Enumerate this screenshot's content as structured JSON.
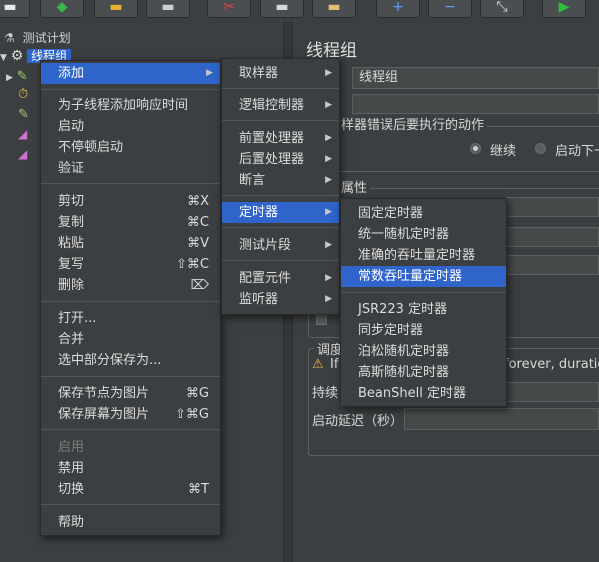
{
  "toolbar": {
    "buttons": [
      "new-icon",
      "templates-icon",
      "open-icon",
      "save-icon",
      "cut-icon",
      "copy-icon",
      "paste-icon",
      "expand-icon",
      "collapse-icon",
      "toggle-icon",
      "start-icon"
    ],
    "symbols": [
      "▬",
      "◆",
      "▬",
      "▬",
      "✂",
      "▬",
      "▬",
      "+",
      "−",
      "⤡",
      "▶"
    ]
  },
  "tree": {
    "root_label": "测试计划",
    "selected_label": "线程组"
  },
  "context_menu": {
    "items": [
      {
        "label": "添加",
        "shortcut": "",
        "submenu": true
      },
      {
        "label": "为子线程添加响应时间",
        "shortcut": ""
      },
      {
        "label": "启动",
        "shortcut": ""
      },
      {
        "label": "不停顿启动",
        "shortcut": ""
      },
      {
        "label": "验证",
        "shortcut": ""
      },
      {
        "label": "剪切",
        "shortcut": "⌘X"
      },
      {
        "label": "复制",
        "shortcut": "⌘C"
      },
      {
        "label": "粘贴",
        "shortcut": "⌘V"
      },
      {
        "label": "复写",
        "shortcut": "⇧⌘C"
      },
      {
        "label": "删除",
        "shortcut": "⌦"
      },
      {
        "label": "打开...",
        "shortcut": ""
      },
      {
        "label": "合并",
        "shortcut": ""
      },
      {
        "label": "选中部分保存为...",
        "shortcut": ""
      },
      {
        "label": "保存节点为图片",
        "shortcut": "⌘G"
      },
      {
        "label": "保存屏幕为图片",
        "shortcut": "⇧⌘G"
      },
      {
        "label": "启用",
        "shortcut": "",
        "disabled": true
      },
      {
        "label": "禁用",
        "shortcut": ""
      },
      {
        "label": "切换",
        "shortcut": "⌘T"
      },
      {
        "label": "帮助",
        "shortcut": ""
      }
    ]
  },
  "add_submenu": {
    "items": [
      {
        "label": "取样器"
      },
      {
        "label": "逻辑控制器"
      },
      {
        "label": "前置处理器"
      },
      {
        "label": "后置处理器"
      },
      {
        "label": "断言"
      },
      {
        "label": "定时器"
      },
      {
        "label": "测试片段"
      },
      {
        "label": "配置元件"
      },
      {
        "label": "监听器"
      }
    ]
  },
  "timer_submenu": {
    "items": [
      {
        "label": "固定定时器"
      },
      {
        "label": "统一随机定时器"
      },
      {
        "label": "准确的吞吐量定时器"
      },
      {
        "label": "常数吞吐量定时器"
      },
      {
        "label": "JSR223 定时器"
      },
      {
        "label": "同步定时器"
      },
      {
        "label": "泊松随机定时器"
      },
      {
        "label": "高斯随机定时器"
      },
      {
        "label": "BeanShell 定时器"
      }
    ]
  },
  "right_panel": {
    "title": "线程组",
    "name_value": "线程组",
    "on_error_label": "样器错误后要执行的动作",
    "continue_label": "继续",
    "start_next_label": "启动下一",
    "properties_label": "属性",
    "scheduler_label": "调度",
    "warning_text": "If",
    "warning_text_tail": "forever, duratio",
    "duration_label": "持续",
    "startup_delay_label": "启动延迟（秒）"
  },
  "colors": {
    "background": "#3c3f41",
    "selection": "#2f65ca",
    "menu_text": "#dcdcdc",
    "disabled_text": "#7c7c7c"
  }
}
